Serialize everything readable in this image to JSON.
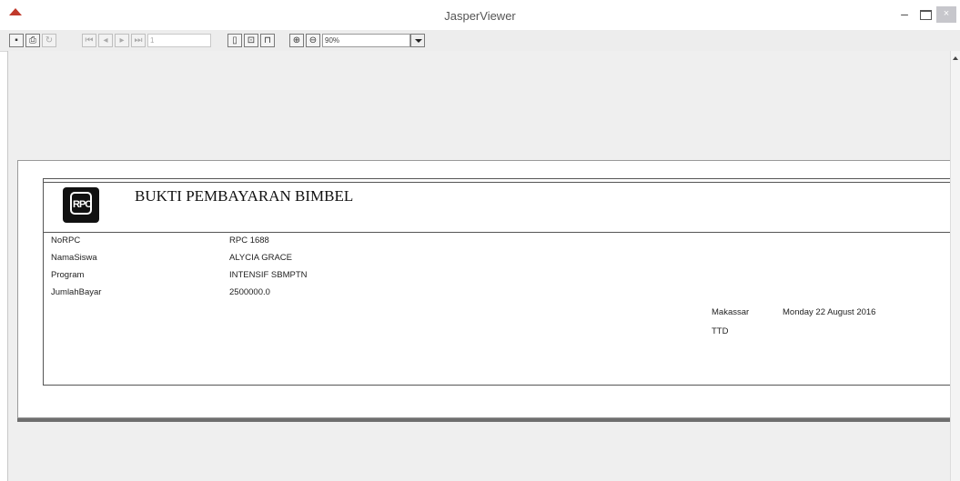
{
  "window": {
    "title": "JasperViewer",
    "minimize": "–",
    "close": "×"
  },
  "toolbar": {
    "page_number": "1",
    "zoom": "90%"
  },
  "report": {
    "title": "BUKTI PEMBAYARAN BIMBEL",
    "logo_text": "RPC",
    "fields": [
      {
        "label": "NoRPC",
        "value": "RPC 1688"
      },
      {
        "label": "NamaSiswa",
        "value": "ALYCIA GRACE"
      },
      {
        "label": "Program",
        "value": "INTENSIF SBMPTN"
      },
      {
        "label": "JumlahBayar",
        "value": "2500000.0"
      }
    ],
    "city": "Makassar",
    "date": "Monday 22 August 2016",
    "signature_label": "TTD"
  }
}
